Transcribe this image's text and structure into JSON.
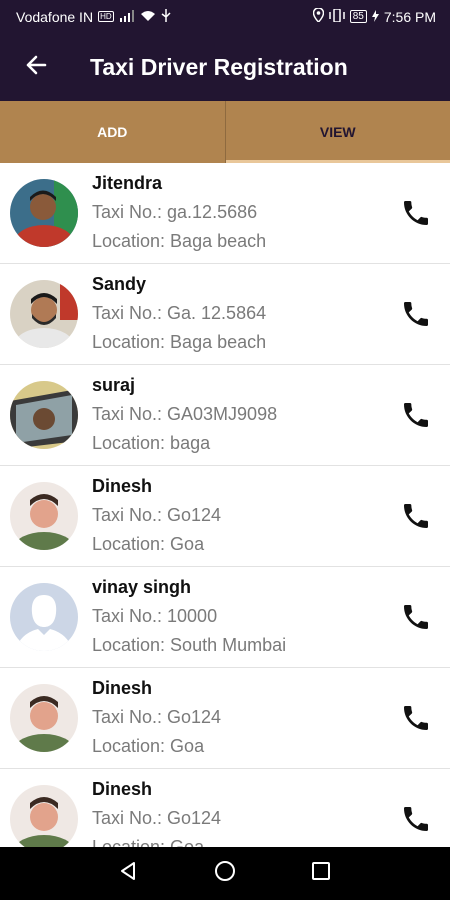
{
  "status_bar": {
    "carrier": "Vodafone IN",
    "network_badge": "HD",
    "battery": "85",
    "time": "7:56 PM"
  },
  "app_bar": {
    "title": "Taxi Driver Registration",
    "back_icon": "arrow-back-icon"
  },
  "tabs": [
    {
      "label": "ADD"
    },
    {
      "label": "VIEW"
    }
  ],
  "drivers": [
    {
      "name": "Jitendra",
      "taxi": "Taxi No.: ga.12.5686",
      "location": "Location: Baga beach",
      "avatar": "photo-man-red-shirt"
    },
    {
      "name": "Sandy",
      "taxi": "Taxi No.: Ga. 12.5864",
      "location": "Location: Baga beach",
      "avatar": "photo-man-beard"
    },
    {
      "name": "suraj",
      "taxi": "Taxi No.: GA03MJ9098",
      "location": "Location: baga",
      "avatar": "photo-in-car"
    },
    {
      "name": "Dinesh",
      "taxi": "Taxi No.: Go124",
      "location": "Location: Goa",
      "avatar": "photo-young-man"
    },
    {
      "name": "vinay singh",
      "taxi": "Taxi No.: 10000",
      "location": "Location: South Mumbai",
      "avatar": "default-avatar"
    },
    {
      "name": "Dinesh",
      "taxi": "Taxi No.: Go124",
      "location": "Location: Goa",
      "avatar": "photo-young-man"
    },
    {
      "name": "Dinesh",
      "taxi": "Taxi No.: Go124",
      "location": "Location: Goa",
      "avatar": "photo-young-man"
    }
  ],
  "colors": {
    "app_bar": "#221531",
    "tab_bar": "#b0844f",
    "tab_indicator": "#e9c79a"
  }
}
